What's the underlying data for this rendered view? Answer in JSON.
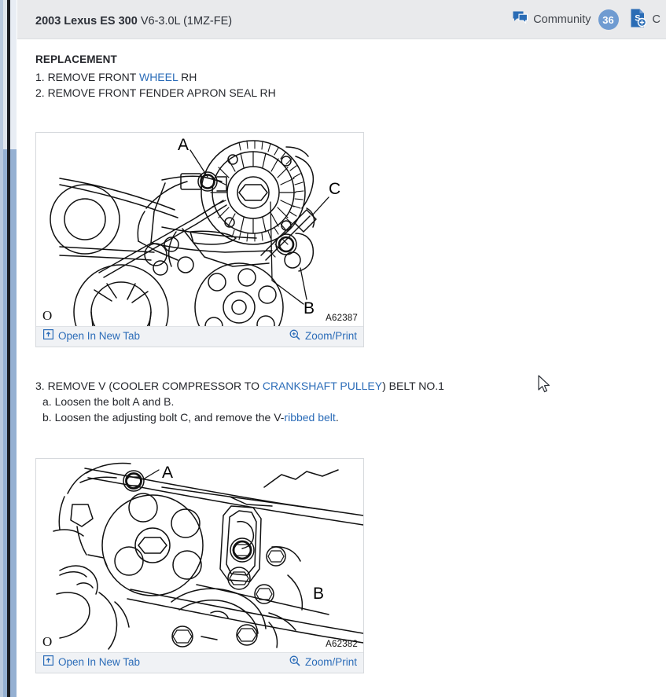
{
  "header": {
    "title_bold": "2003 Lexus ES 300",
    "title_regular": "V6-3.0L (1MZ-FE)",
    "community_label": "Community",
    "community_count": "36",
    "community_icon": "chat-bubble-icon",
    "estimate_label": "C",
    "estimate_icon": "dollar-document-add-icon"
  },
  "content": {
    "section_title": "REPLACEMENT",
    "step1_prefix": "1. REMOVE FRONT ",
    "step1_link": "WHEEL",
    "step1_suffix": " RH",
    "step2": "2. REMOVE FRONT FENDER APRON SEAL RH",
    "step3_prefix": "3. REMOVE V (COOLER COMPRESSOR TO ",
    "step3_link": "CRANKSHAFT PULLEY",
    "step3_suffix": ") BELT NO.1",
    "step3a": "a. Loosen the bolt A and B.",
    "step3b_prefix": "b. Loosen the adjusting bolt C, and remove the V-",
    "step3b_link": "ribbed belt",
    "step3b_suffix": "."
  },
  "figures": [
    {
      "id": "A62387",
      "origin_mark": "O",
      "labels": [
        "A",
        "C",
        "B"
      ],
      "open_in_new_tab": "Open In New Tab",
      "open_icon": "open-in-new-tab-icon",
      "zoom_print": "Zoom/Print",
      "zoom_icon": "magnifier-plus-icon",
      "caption": "Alternator and drive belt assembly with bolts A, B and adjusting bolt C"
    },
    {
      "id": "A62382",
      "origin_mark": "O",
      "labels": [
        "A",
        "B"
      ],
      "open_in_new_tab": "Open In New Tab",
      "open_icon": "open-in-new-tab-icon",
      "zoom_print": "Zoom/Print",
      "zoom_icon": "magnifier-plus-icon",
      "caption": "Cooler compressor pulley and mounting bolts A and B"
    }
  ],
  "colors": {
    "header_bg": "#e9eaec",
    "link_blue": "#2b6cb8",
    "badge_blue": "#6f9bd1",
    "toolbar_bg": "#f0f2f5",
    "sidebar_blue": "#95b0d2",
    "text_dark": "#24262b"
  }
}
